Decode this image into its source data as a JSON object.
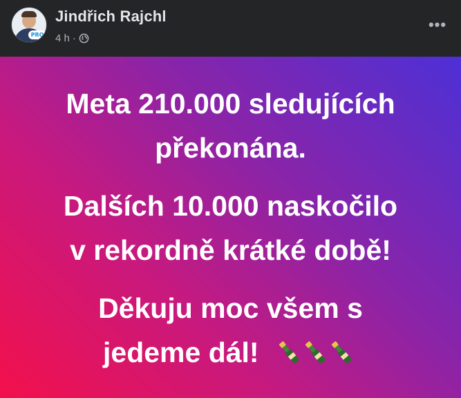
{
  "post": {
    "author": "Jindřich Rajchl",
    "timestamp": "4 h",
    "separator": "·",
    "audience_icon": "globe-icon",
    "more_label": "•••",
    "avatar_badge": "PRO"
  },
  "content": {
    "paragraphs": [
      {
        "lines": [
          "Meta 210.000 sledujících",
          "překonána."
        ]
      },
      {
        "lines": [
          "Dalších 10.000 naskočilo",
          "v rekordně krátké době!"
        ]
      },
      {
        "lines": [
          "Děkuju moc všem s",
          "jedeme dál!"
        ]
      }
    ],
    "emoji": "champagne-bottle-icon",
    "emoji_count": 3,
    "gradient_colors": [
      "#f3104b",
      "#c8197e",
      "#8a24a8",
      "#4d30d6"
    ]
  },
  "colors": {
    "header_bg": "#242526",
    "author_text": "#e4e6eb",
    "meta_text": "#b0b3b8"
  }
}
